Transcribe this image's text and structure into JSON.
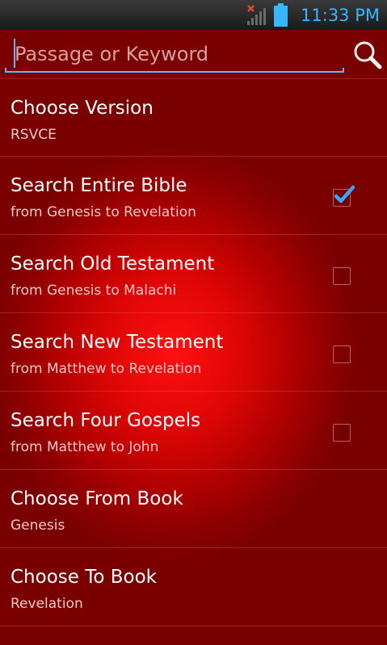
{
  "status_bar": {
    "time": "11:33 PM",
    "icons": [
      "signal-no-service-icon",
      "battery-icon"
    ],
    "accent_color": "#38b6ff"
  },
  "search": {
    "placeholder": "Passage or Keyword",
    "value": "",
    "button_icon": "search-icon"
  },
  "options": [
    {
      "title": "Choose Version",
      "subtitle": "RSVCE",
      "has_checkbox": false
    },
    {
      "title": "Search Entire Bible",
      "subtitle": "from Genesis to Revelation",
      "has_checkbox": true,
      "checked": true
    },
    {
      "title": "Search Old Testament",
      "subtitle": "from Genesis to Malachi",
      "has_checkbox": true,
      "checked": false
    },
    {
      "title": "Search New Testament",
      "subtitle": "from Matthew to Revelation",
      "has_checkbox": true,
      "checked": false
    },
    {
      "title": "Search Four Gospels",
      "subtitle": "from Matthew to John",
      "has_checkbox": true,
      "checked": false
    },
    {
      "title": "Choose From Book",
      "subtitle": "Genesis",
      "has_checkbox": false
    },
    {
      "title": "Choose To Book",
      "subtitle": "Revelation",
      "has_checkbox": false
    }
  ],
  "colors": {
    "background_center": "#ff1010",
    "background_edge": "#7a0000",
    "check_color": "#3aa8ff"
  }
}
